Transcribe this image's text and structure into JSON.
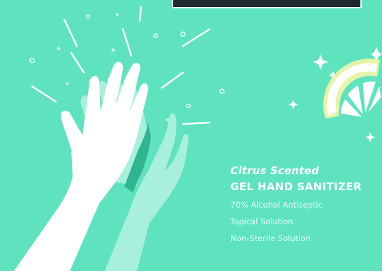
{
  "product": {
    "scent": "Citrus Scented",
    "name": "GEL HAND SANITIZER",
    "details": [
      "70% Alcohol Antiseptic",
      "Topical Solution",
      "Non-Sterile Solution"
    ]
  },
  "colors": {
    "background": "#5fe3bf",
    "hand_front": "#ffffff",
    "hand_back": "#a8f0dc",
    "hand_shadow": "#2fb58f",
    "top_band": "#1c2a2f",
    "citrus_rind": "#e6f4a8"
  },
  "icons": [
    "high-five-hands-icon",
    "citrus-slice-icon",
    "sparkle-icon",
    "burst-lines-icon"
  ]
}
